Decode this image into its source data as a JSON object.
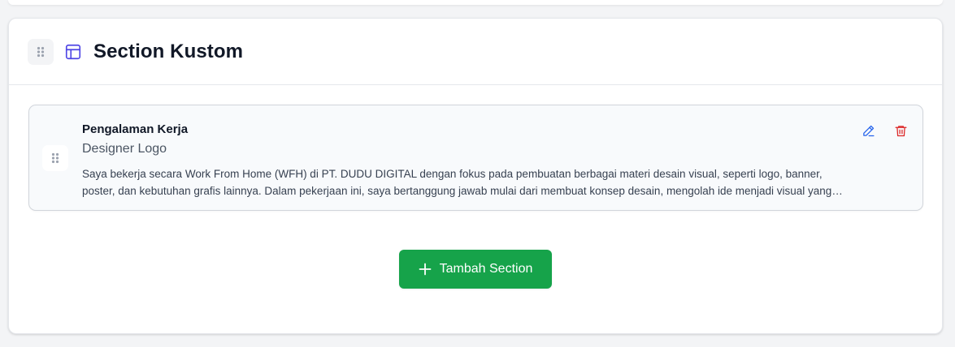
{
  "section": {
    "title": "Section Kustom",
    "icons": {
      "drag": "grip-dots-icon",
      "section": "layout-icon",
      "edit": "pencil-icon",
      "delete": "trash-icon",
      "add": "plus-icon"
    }
  },
  "items": [
    {
      "title": "Pengalaman Kerja",
      "subtitle": "Designer Logo",
      "description": "Saya bekerja secara Work From Home (WFH) di PT. DUDU DIGITAL dengan fokus pada pembuatan berbagai materi desain visual, seperti logo, banner, poster, dan kebutuhan grafis lainnya. Dalam pekerjaan ini, saya bertanggung jawab mulai dari membuat konsep desain, mengolah ide menjadi visual yang menarik, hingga menyelesaikan revisi sesuai kebutuhan klien."
    }
  ],
  "add_button": {
    "label": "Tambah Section"
  },
  "colors": {
    "accent_icon": "#4f46e5",
    "edit": "#2563eb",
    "delete": "#dc2626",
    "add_button": "#16a34a"
  }
}
